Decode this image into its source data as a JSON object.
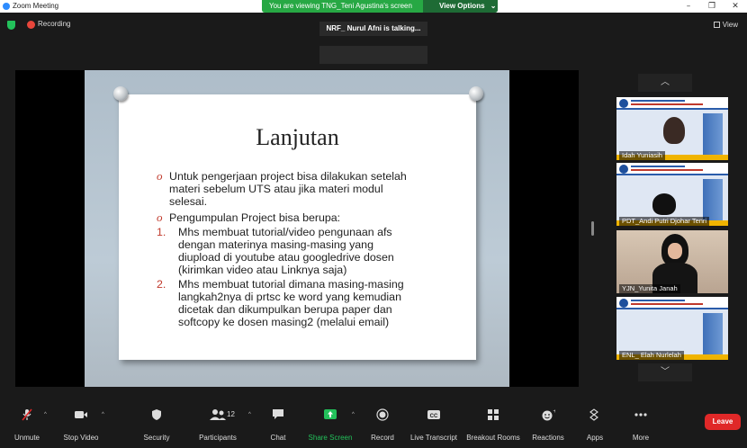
{
  "window": {
    "title": "Zoom Meeting",
    "sharing_banner": "You are viewing TNG_Teni Agustina's screen",
    "view_options": "View Options"
  },
  "topbar": {
    "recording_label": "Recording",
    "talking_indicator": "NRF_ Nurul Afni is talking...",
    "view_label": "View"
  },
  "slide": {
    "title": "Lanjutan",
    "bullets": [
      "Untuk pengerjaan project bisa dilakukan setelah materi sebelum UTS atau jika materi modul selesai.",
      "Pengumpulan Project bisa berupa:"
    ],
    "numbered": [
      "Mhs membuat tutorial/video pengunaan afs dengan materinya masing-masing yang diupload di youtube atau googledrive dosen (kirimkan video atau Linknya saja)",
      "Mhs membuat tutorial dimana masing-masing langkah2nya di prtsc ke word yang kemudian dicetak dan dikumpulkan berupa paper dan softcopy ke dosen masing2 (melalui email)"
    ],
    "bullet_lines": [
      [
        "Untuk pengerjaan project bisa dilakukan setelah",
        "materi sebelum UTS atau jika materi modul",
        "selesai."
      ],
      [
        "Pengumpulan Project bisa berupa:"
      ]
    ],
    "numbered_lines": [
      [
        "Mhs membuat tutorial/video pengunaan afs",
        "dengan materinya masing-masing yang",
        "diupload di youtube atau googledrive dosen",
        "(kirimkan video atau Linknya saja)"
      ],
      [
        "Mhs membuat tutorial dimana masing-masing",
        "langkah2nya di prtsc ke word yang kemudian",
        "dicetak dan dikumpulkan berupa paper dan",
        "softcopy ke dosen masing2 (melalui email)"
      ]
    ],
    "bullet_marker": "o",
    "number_labels": [
      "1.",
      "2."
    ]
  },
  "gallery": {
    "participants": [
      {
        "name": "Idah Yuniasih"
      },
      {
        "name": "PDT_Andi Putri Djohar Tenri"
      },
      {
        "name": "YJN_Yunita Janah"
      },
      {
        "name": "ENL_ Elah Nurlelah"
      }
    ]
  },
  "toolbar": {
    "unmute": "Unmute",
    "stop_video": "Stop Video",
    "security": "Security",
    "participants": "Participants",
    "participants_count": "12",
    "chat": "Chat",
    "share_screen": "Share Screen",
    "record": "Record",
    "live_transcript": "Live Transcript",
    "breakout_rooms": "Breakout Rooms",
    "reactions": "Reactions",
    "apps": "Apps",
    "more": "More",
    "leave": "Leave"
  },
  "colors": {
    "accent_green": "#27a844",
    "share_green": "#23c15b",
    "leave_red": "#e02828",
    "bullet_red": "#c0392b"
  }
}
